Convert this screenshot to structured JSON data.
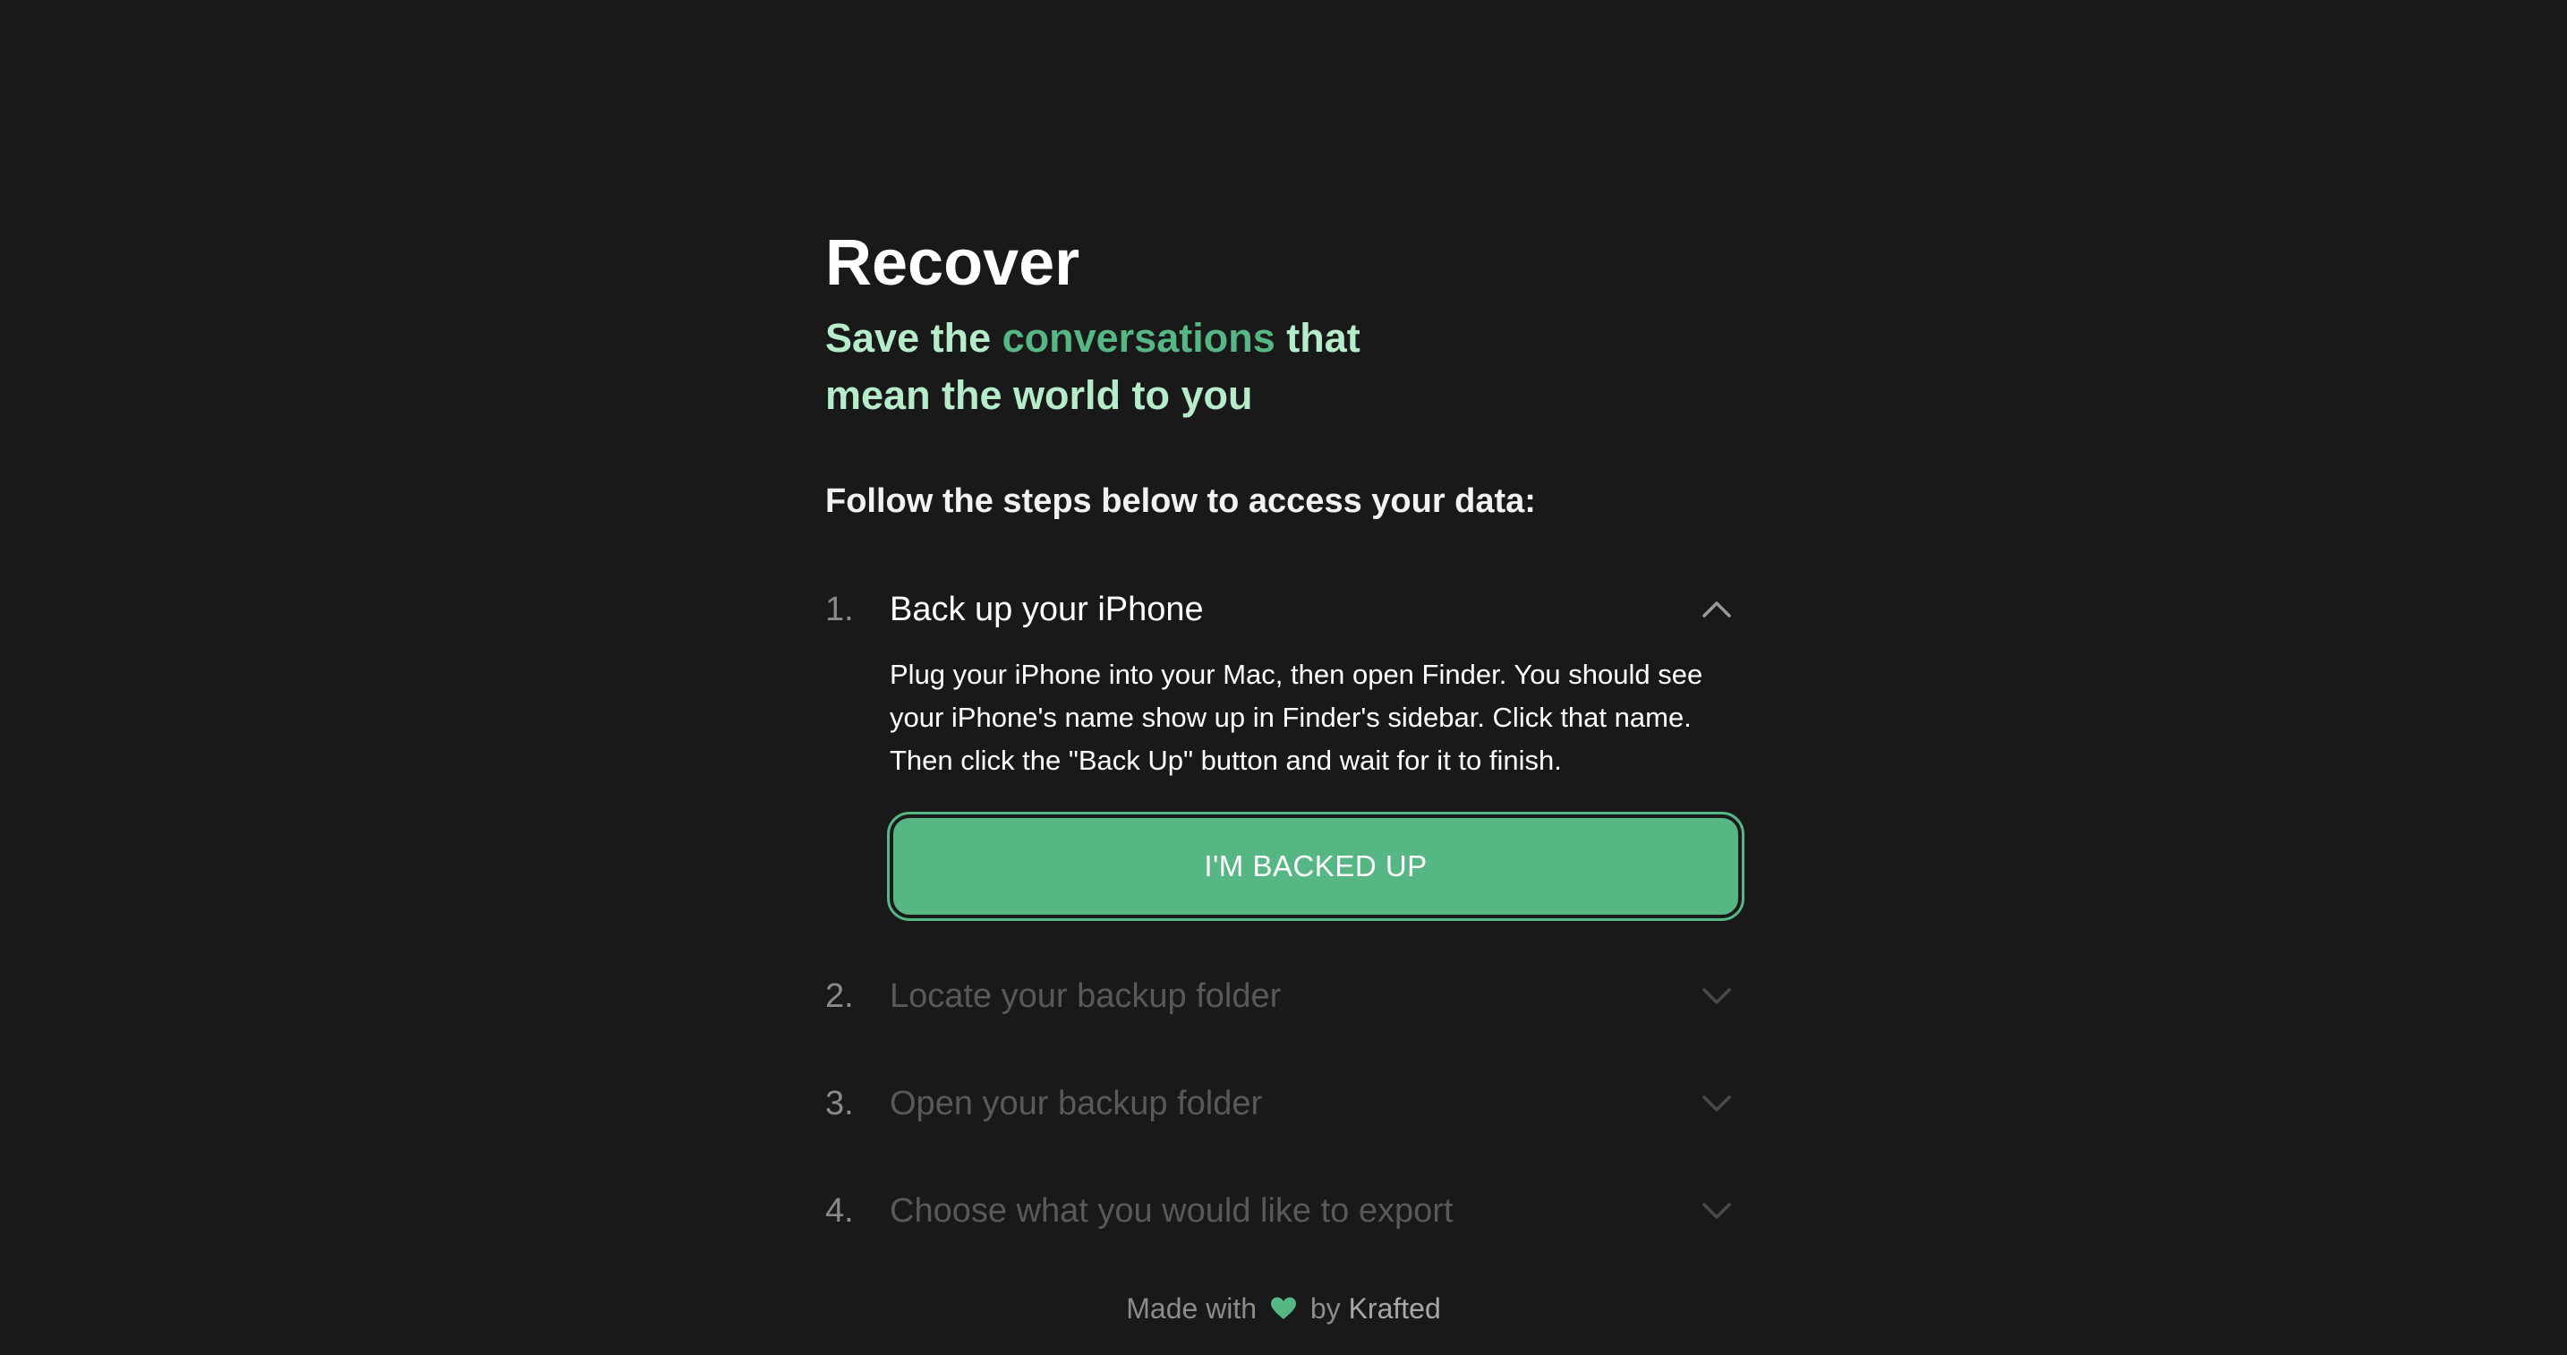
{
  "header": {
    "title": "Recover",
    "subtitle_before": "Save the ",
    "subtitle_accent": "conversations",
    "subtitle_after": " that mean the world to you",
    "instructions": "Follow the steps below to access your data:"
  },
  "steps": [
    {
      "number": "1.",
      "title": "Back up your iPhone",
      "expanded": true,
      "icon": "chevron-up-icon",
      "body": "Plug your iPhone into your Mac, then open Finder. You should see your iPhone's name show up in Finder's sidebar. Click that name. Then click the \"Back Up\" button and wait for it to finish.",
      "button_label": "I'M BACKED UP"
    },
    {
      "number": "2.",
      "title": "Locate your backup folder",
      "expanded": false,
      "icon": "chevron-down-icon"
    },
    {
      "number": "3.",
      "title": "Open your backup folder",
      "expanded": false,
      "icon": "chevron-down-icon"
    },
    {
      "number": "4.",
      "title": "Choose what you would like to export",
      "expanded": false,
      "icon": "chevron-down-icon"
    }
  ],
  "footer": {
    "made_with": "Made with",
    "icon": "heart-icon",
    "by": "by",
    "brand": "Krafted"
  },
  "colors": {
    "background": "#191919",
    "accent": "#56b785",
    "subtitle": "#b6ecca",
    "muted": "#595959"
  }
}
